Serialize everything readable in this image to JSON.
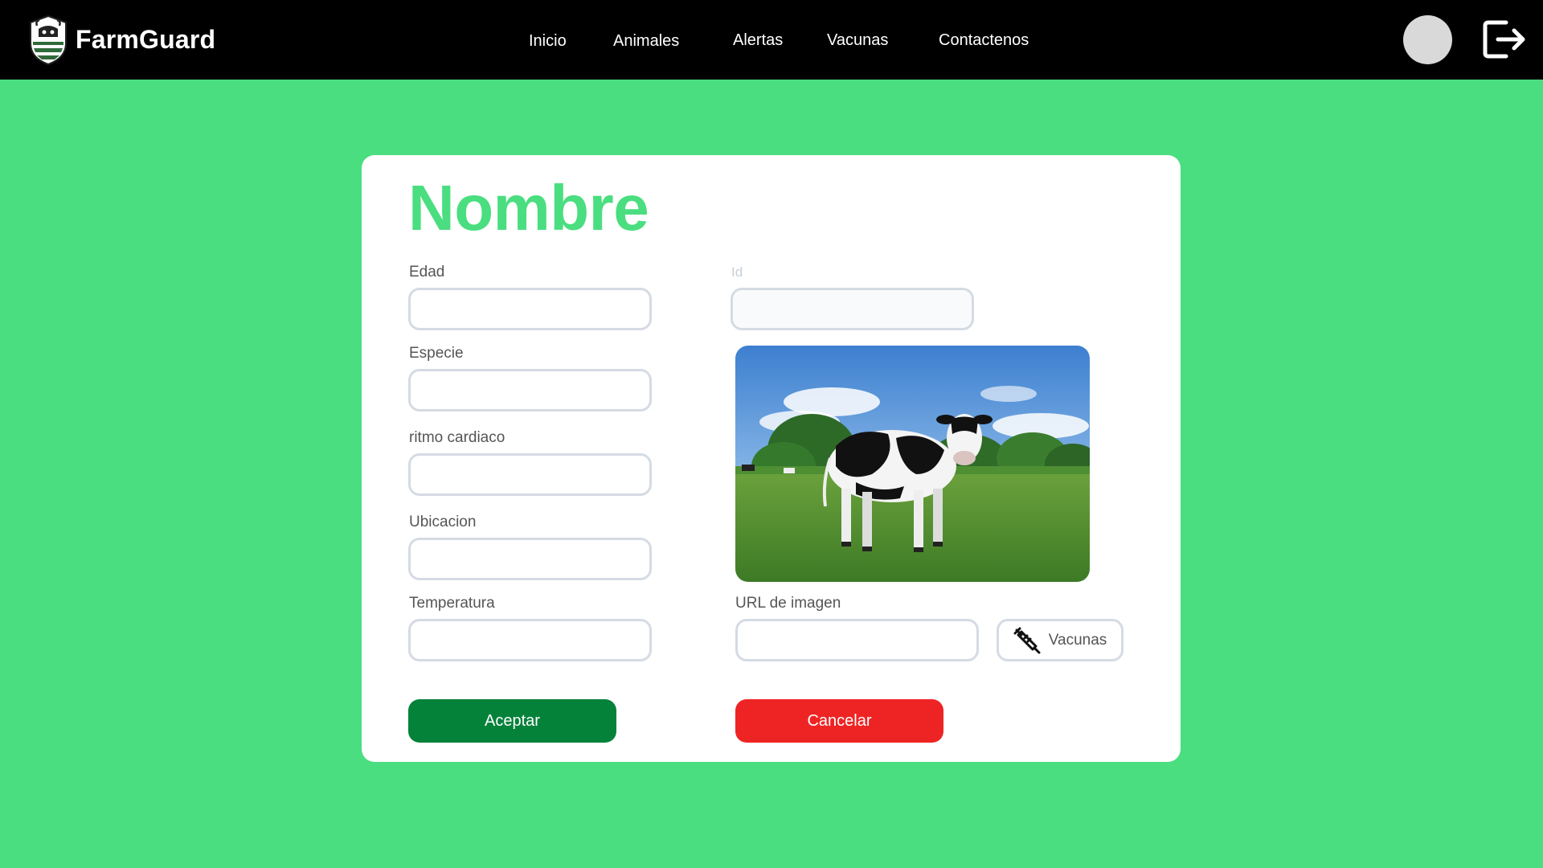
{
  "header": {
    "brand": "FarmGuard",
    "nav": [
      {
        "label": "Inicio"
      },
      {
        "label": "Animales"
      },
      {
        "label": "Alertas"
      },
      {
        "label": "Vacunas"
      },
      {
        "label": "Contactenos"
      }
    ],
    "icons": {
      "logo": "shield-cow-logo",
      "avatar": "user-avatar",
      "logout": "logout-icon"
    }
  },
  "form": {
    "title": "Nombre",
    "fields": {
      "edad": {
        "label": "Edad",
        "value": ""
      },
      "id": {
        "label": "Id",
        "value": ""
      },
      "especie": {
        "label": "Especie",
        "value": ""
      },
      "ritmo": {
        "label": "ritmo cardiaco",
        "value": ""
      },
      "ubicacion": {
        "label": "Ubicacion",
        "value": ""
      },
      "temperatura": {
        "label": "Temperatura",
        "value": ""
      },
      "url": {
        "label": "URL de imagen",
        "value": ""
      }
    },
    "vaccines_button": {
      "label": "Vacunas",
      "icon": "syringe-icon"
    },
    "accept_label": "Aceptar",
    "cancel_label": "Cancelar",
    "image_subject": "holstein-cow-in-pasture"
  },
  "colors": {
    "background": "#4ade80",
    "header": "#000000",
    "accept": "#05823a",
    "cancel": "#ee2424",
    "title": "#4ade80"
  }
}
